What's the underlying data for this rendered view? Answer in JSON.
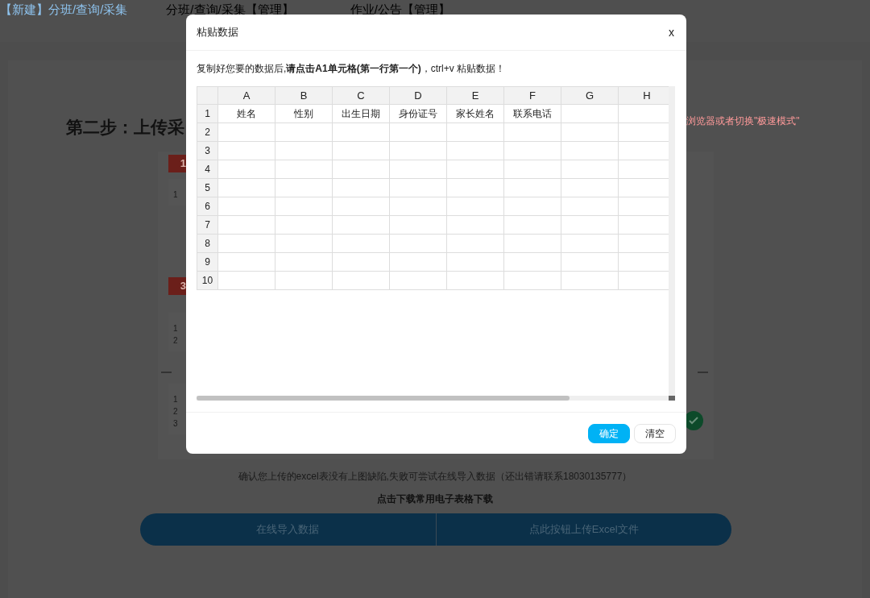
{
  "nav": [
    {
      "label": "【新建】分班/查询/采集",
      "selected": true
    },
    {
      "label": "分班/查询/采集【管理】",
      "selected": false
    },
    {
      "label": "作业/公告【管理】",
      "selected": false
    }
  ],
  "step_title": "第二步：上传采",
  "warning": "浏览器或者切换\"极速模式\"",
  "step_badges": [
    "1",
    "3"
  ],
  "preview_tables": [
    {
      "rows": [
        "1"
      ]
    },
    {
      "rows": [
        "1",
        "2"
      ]
    },
    {
      "rows": [
        "1",
        "2",
        "3"
      ]
    }
  ],
  "note": "确认您上传的excel表没有上图缺陷,失败可尝试在线导入数据（还出错请联系18030135777）",
  "download_link": "点击下载常用电子表格下载",
  "actions": [
    "在线导入数据",
    "点此按钮上传Excel文件"
  ],
  "dialog": {
    "title": "粘贴数据",
    "close": "x",
    "instruction": "复制好您要的数据后,**请点击A1单元格(第一行第一个)**，ctrl+v 粘贴数据！",
    "sheet": {
      "columns": [
        "A",
        "B",
        "C",
        "D",
        "E",
        "F",
        "G",
        "H"
      ],
      "rows": [
        {
          "row": "1",
          "cells": [
            "姓名",
            "性别",
            "出生日期",
            "身份证号",
            "家长姓名",
            "联系电话"
          ]
        },
        {
          "row": "2"
        },
        {
          "row": "3"
        },
        {
          "row": "4"
        },
        {
          "row": "5"
        },
        {
          "row": "6"
        },
        {
          "row": "7"
        },
        {
          "row": "8"
        },
        {
          "row": "9"
        },
        {
          "row": "10"
        }
      ]
    },
    "buttons": [
      {
        "label": "确定",
        "kind": "primary"
      },
      {
        "label": "清空",
        "kind": "secondary"
      }
    ]
  }
}
